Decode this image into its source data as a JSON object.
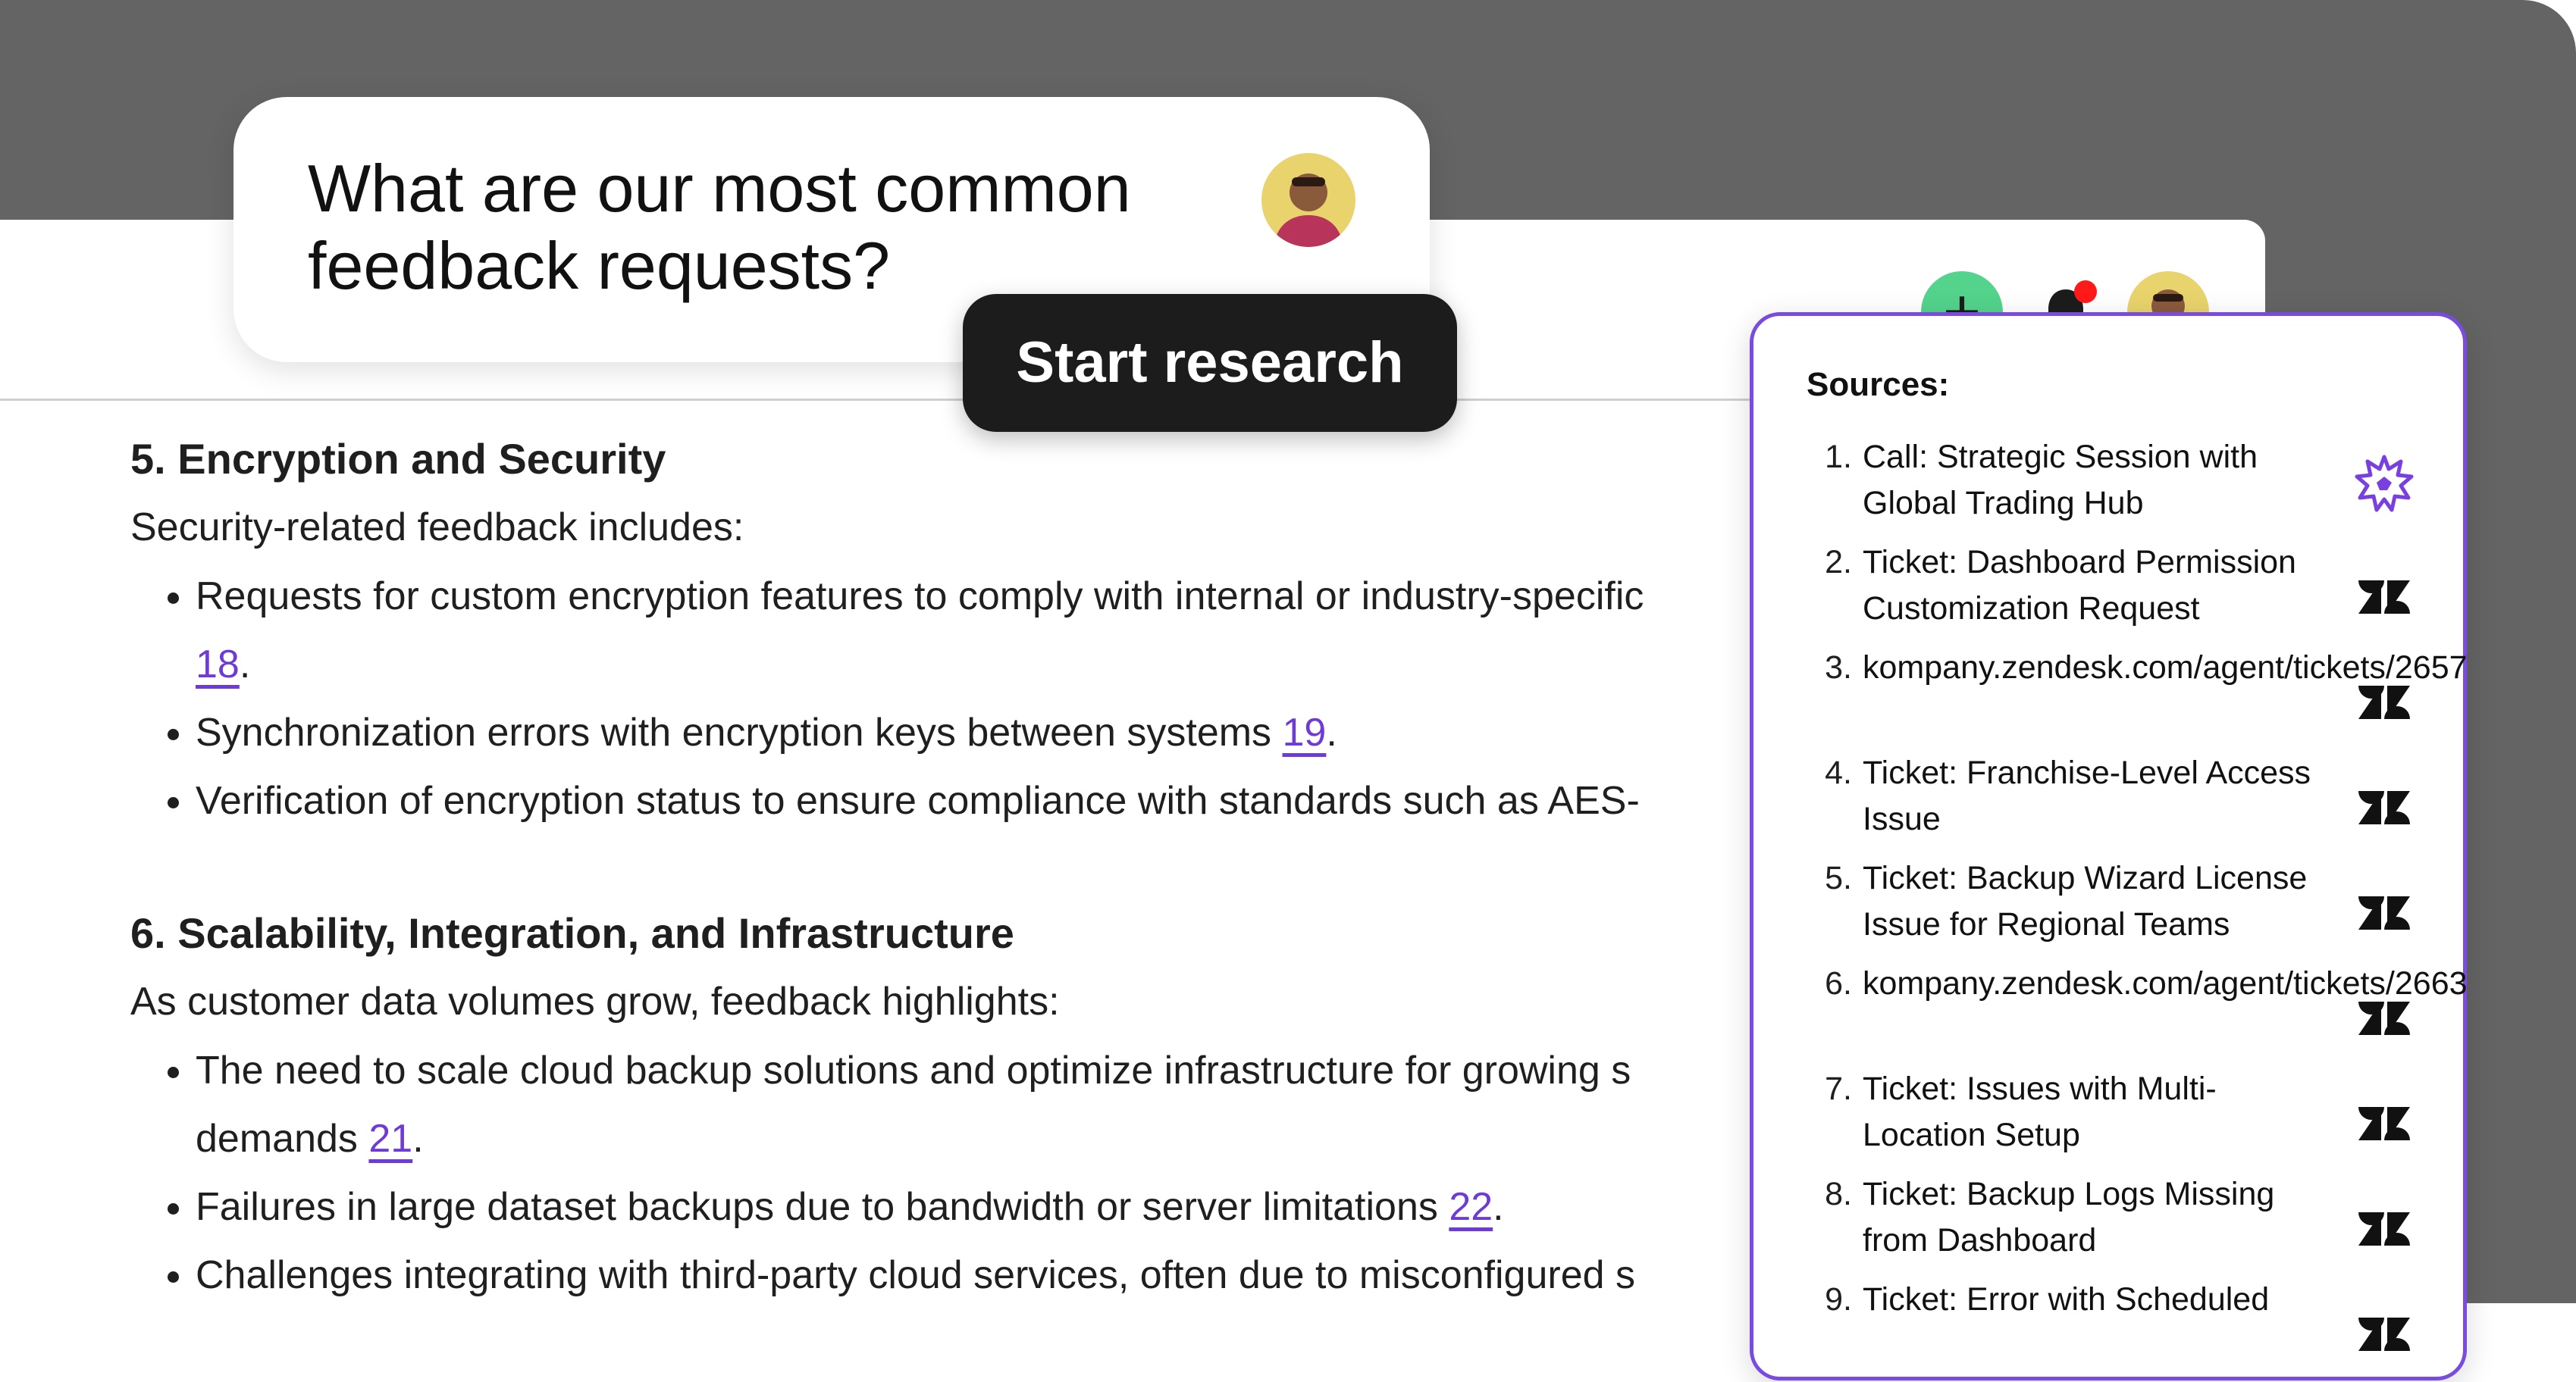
{
  "chat": {
    "question": "What are our most common feedback requests?",
    "start_button": "Start research"
  },
  "header": {
    "add_label": "+"
  },
  "report": {
    "s5": {
      "heading": "5. Encryption and Security",
      "intro": "Security-related feedback includes:",
      "b1_text": "Requests for custom encryption features to comply with internal or industry-specific",
      "b1_cite": "18",
      "b2_text": "Synchronization errors with encryption keys between systems ",
      "b2_cite": "19",
      "b3_text": "Verification of encryption status to ensure compliance with standards such as AES-"
    },
    "s6": {
      "heading": "6. Scalability, Integration, and Infrastructure",
      "intro": "As customer data volumes grow, feedback highlights:",
      "b1_text": "The need to scale cloud backup solutions and optimize infrastructure for growing s",
      "b1_text2": "demands ",
      "b1_cite": "21",
      "b2_text": "Failures in large dataset backups due to bandwidth or server limitations ",
      "b2_cite": "22",
      "b3_text": "Challenges integrating with third-party cloud services, often due to misconfigured s"
    }
  },
  "sources": {
    "title": "Sources:",
    "items": [
      {
        "num": "1.",
        "text": "Call: Strategic Session with Global Trading Hub",
        "icon": "gong-icon"
      },
      {
        "num": "2.",
        "text": "Ticket: Dashboard Permission Customization Request",
        "icon": "zendesk-icon"
      },
      {
        "num": "3.",
        "text": "kompany.zendesk.com/agent/tickets/2657",
        "icon": "zendesk-icon"
      },
      {
        "num": "4.",
        "text": "Ticket: Franchise-Level Access Issue",
        "icon": "zendesk-icon"
      },
      {
        "num": "5.",
        "text": "Ticket: Backup Wizard License Issue for Regional Teams",
        "icon": "zendesk-icon"
      },
      {
        "num": "6.",
        "text": "kompany.zendesk.com/agent/tickets/2663",
        "icon": "zendesk-icon"
      },
      {
        "num": "7.",
        "text": "Ticket: Issues with Multi-Location Setup",
        "icon": "zendesk-icon"
      },
      {
        "num": "8.",
        "text": "Ticket: Backup Logs Missing from Dashboard",
        "icon": "zendesk-icon"
      },
      {
        "num": "9.",
        "text": "Ticket: Error with Scheduled",
        "icon": "zendesk-icon"
      }
    ]
  },
  "colors": {
    "accent": "#6e3bd6",
    "add_button": "#53d38b",
    "notification_dot": "#ff1a1a",
    "backdrop": "#646464"
  }
}
